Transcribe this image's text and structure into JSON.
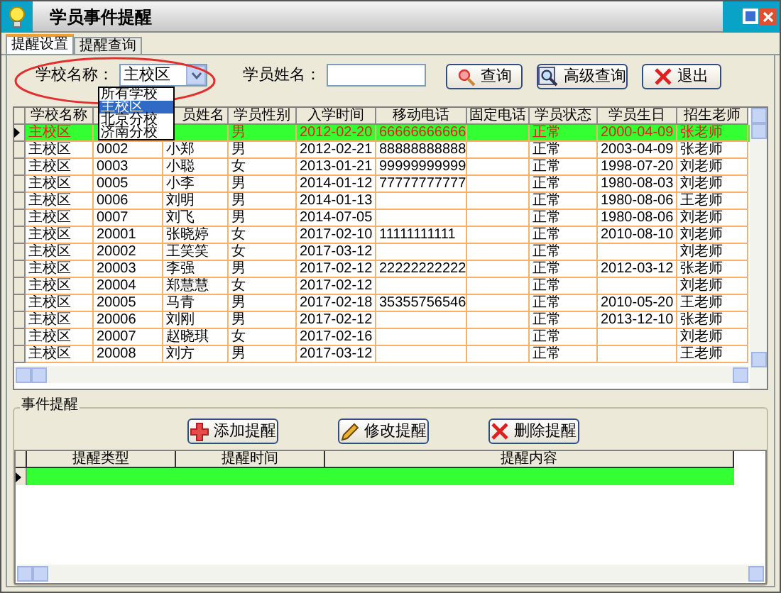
{
  "window": {
    "title": "学员事件提醒"
  },
  "tabs": [
    {
      "label": "提醒设置",
      "selected": true
    },
    {
      "label": "提醒查询",
      "selected": false
    }
  ],
  "search": {
    "school_label": "学校名称：",
    "school_value": "主校区",
    "school_options": [
      {
        "label": "所有学校",
        "selected": false
      },
      {
        "label": "主校区",
        "selected": true
      },
      {
        "label": "北京分校",
        "selected": false
      },
      {
        "label": "济南分校",
        "selected": false
      }
    ],
    "name_label": "学员姓名：",
    "buttons": [
      {
        "kind": "search",
        "label": "查询"
      },
      {
        "kind": "advanced",
        "label": "高级查询"
      },
      {
        "kind": "exit",
        "label": "退出"
      }
    ]
  },
  "students": {
    "columns": [
      "学校名称",
      null,
      "员姓名",
      "学员性别",
      "入学时间",
      "移动电话",
      "固定电话",
      "学员状态",
      "学员生日",
      "招生老师"
    ],
    "rows": [
      {
        "selected": true,
        "cells": [
          "主校区",
          null,
          null,
          "男",
          "2012-02-20",
          "66666666666",
          null,
          "正常",
          "2000-04-09",
          "张老师"
        ]
      },
      {
        "selected": false,
        "cells": [
          "主校区",
          "0002",
          "小郑",
          "男",
          "2012-02-21",
          "88888888888",
          null,
          "正常",
          "2003-04-09",
          "张老师"
        ]
      },
      {
        "selected": false,
        "cells": [
          "主校区",
          "0003",
          "小聪",
          "女",
          "2013-01-21",
          "99999999999",
          null,
          "正常",
          "1998-07-20",
          "刘老师"
        ]
      },
      {
        "selected": false,
        "cells": [
          "主校区",
          "0005",
          "小李",
          "男",
          "2014-01-12",
          "77777777777",
          null,
          "正常",
          "1980-08-03",
          "刘老师"
        ]
      },
      {
        "selected": false,
        "cells": [
          "主校区",
          "0006",
          "刘明",
          "男",
          "2014-01-13",
          null,
          null,
          "正常",
          "1980-08-06",
          "王老师"
        ]
      },
      {
        "selected": false,
        "cells": [
          "主校区",
          "0007",
          "刘飞",
          "男",
          "2014-07-05",
          null,
          null,
          "正常",
          "1980-08-06",
          "刘老师"
        ]
      },
      {
        "selected": false,
        "cells": [
          "主校区",
          "20001",
          "张晓婷",
          "女",
          "2017-02-10",
          "11111111111",
          null,
          "正常",
          "2010-08-10",
          "刘老师"
        ]
      },
      {
        "selected": false,
        "cells": [
          "主校区",
          "20002",
          "王笑笑",
          "女",
          "2017-03-12",
          null,
          null,
          "正常",
          null,
          "刘老师"
        ]
      },
      {
        "selected": false,
        "cells": [
          "主校区",
          "20003",
          "李强",
          "男",
          "2017-02-12",
          "22222222222",
          null,
          "正常",
          "2012-03-12",
          "张老师"
        ]
      },
      {
        "selected": false,
        "cells": [
          "主校区",
          "20004",
          "郑慧慧",
          "女",
          "2017-02-12",
          null,
          null,
          "正常",
          null,
          "刘老师"
        ]
      },
      {
        "selected": false,
        "cells": [
          "主校区",
          "20005",
          "马青",
          "男",
          "2017-02-18",
          "35355756546",
          null,
          "正常",
          "2010-05-20",
          "王老师"
        ]
      },
      {
        "selected": false,
        "cells": [
          "主校区",
          "20006",
          "刘刚",
          "男",
          "2017-02-12",
          null,
          null,
          "正常",
          "2013-12-10",
          "张老师"
        ]
      },
      {
        "selected": false,
        "cells": [
          "主校区",
          "20007",
          "赵晓琪",
          "女",
          "2017-02-16",
          null,
          null,
          "正常",
          null,
          "刘老师"
        ]
      },
      {
        "selected": false,
        "cells": [
          "主校区",
          "20008",
          "刘方",
          "男",
          "2017-03-12",
          null,
          null,
          "正常",
          null,
          "王老师"
        ]
      }
    ]
  },
  "events": {
    "title": "事件提醒",
    "buttons": [
      {
        "kind": "add",
        "label": "添加提醒"
      },
      {
        "kind": "edit",
        "label": "修改提醒"
      },
      {
        "kind": "delete",
        "label": "删除提醒"
      }
    ],
    "columns": [
      "提醒类型",
      "提醒时间",
      "提醒内容"
    ],
    "rows": [
      {
        "selected": true
      }
    ]
  }
}
